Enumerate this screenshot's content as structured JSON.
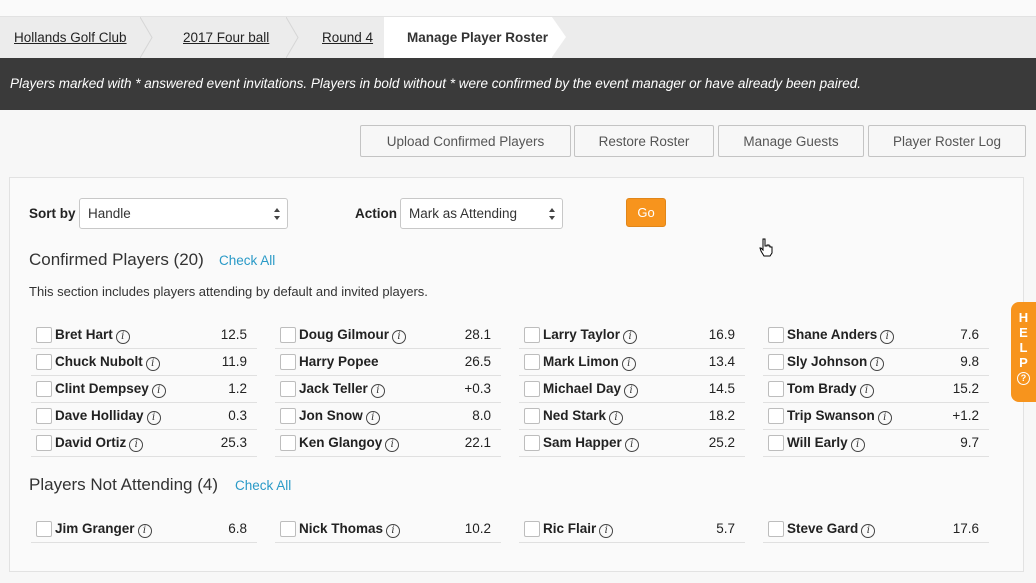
{
  "breadcrumb": {
    "items": [
      "Hollands Golf Club",
      "2017 Four ball",
      "Round 4"
    ],
    "current": "Manage Player Roster"
  },
  "banner": {
    "text": "Players marked with * answered event invitations. Players in bold without * were confirmed by the event manager or have already been paired."
  },
  "toolbar": {
    "upload": "Upload Confirmed Players",
    "restore": "Restore Roster",
    "guests": "Manage Guests",
    "log": "Player Roster Log"
  },
  "controls": {
    "sort_label": "Sort by",
    "sort_value": "Handle",
    "action_label": "Action",
    "action_value": "Mark as Attending",
    "go": "Go"
  },
  "confirmed": {
    "title": "Confirmed Players (20)",
    "check_all": "Check All",
    "note": "This section includes players attending by default and invited players.",
    "columns": [
      [
        {
          "name": "Bret Hart",
          "hc": "12.5",
          "info": true
        },
        {
          "name": "Chuck Nubolt",
          "hc": "11.9",
          "info": true
        },
        {
          "name": "Clint Dempsey",
          "hc": "1.2",
          "info": true
        },
        {
          "name": "Dave Holliday",
          "hc": "0.3",
          "info": true
        },
        {
          "name": "David Ortiz",
          "hc": "25.3",
          "info": true
        }
      ],
      [
        {
          "name": "Doug Gilmour",
          "hc": "28.1",
          "info": true
        },
        {
          "name": "Harry Popee",
          "hc": "26.5",
          "info": false
        },
        {
          "name": "Jack Teller",
          "hc": "+0.3",
          "info": true
        },
        {
          "name": "Jon Snow",
          "hc": "8.0",
          "info": true
        },
        {
          "name": "Ken Glangoy",
          "hc": "22.1",
          "info": true
        }
      ],
      [
        {
          "name": "Larry Taylor",
          "hc": "16.9",
          "info": true
        },
        {
          "name": "Mark Limon",
          "hc": "13.4",
          "info": true
        },
        {
          "name": "Michael Day",
          "hc": "14.5",
          "info": true
        },
        {
          "name": "Ned Stark",
          "hc": "18.2",
          "info": true
        },
        {
          "name": "Sam Happer",
          "hc": "25.2",
          "info": true
        }
      ],
      [
        {
          "name": "Shane Anders",
          "hc": "7.6",
          "info": true
        },
        {
          "name": "Sly Johnson",
          "hc": "9.8",
          "info": true
        },
        {
          "name": "Tom Brady",
          "hc": "15.2",
          "info": true
        },
        {
          "name": "Trip Swanson",
          "hc": "+1.2",
          "info": true
        },
        {
          "name": "Will Early",
          "hc": "9.7",
          "info": true
        }
      ]
    ]
  },
  "not_attending": {
    "title": "Players Not Attending (4)",
    "check_all": "Check All",
    "players": [
      {
        "name": "Jim Granger",
        "hc": "6.8",
        "info": true
      },
      {
        "name": "Nick Thomas",
        "hc": "10.2",
        "info": true
      },
      {
        "name": "Ric Flair",
        "hc": "5.7",
        "info": true
      },
      {
        "name": "Steve Gard",
        "hc": "17.6",
        "info": true
      }
    ]
  },
  "help": {
    "letters": [
      "H",
      "E",
      "L",
      "P"
    ],
    "icon": "?"
  },
  "colors": {
    "accent": "#f7941d",
    "link": "#2a9ac7",
    "banner_bg": "#3a3a3a"
  }
}
